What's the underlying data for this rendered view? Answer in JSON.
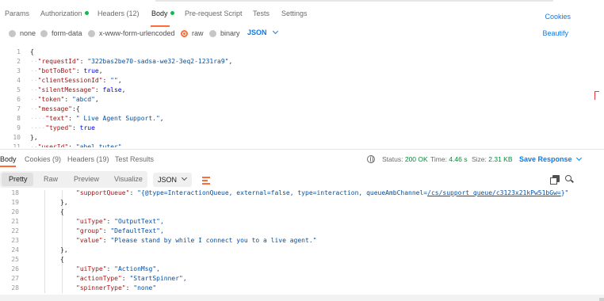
{
  "request_tabs": {
    "params": "Params",
    "authorization": "Authorization",
    "headers": "Headers",
    "headers_count": "(12)",
    "body": "Body",
    "prerequest": "Pre-request Script",
    "tests": "Tests",
    "settings": "Settings",
    "cookies": "Cookies"
  },
  "body_types": {
    "none": "none",
    "form_data": "form-data",
    "urlencoded": "x-www-form-urlencoded",
    "raw": "raw",
    "binary": "binary",
    "format": "JSON",
    "beautify": "Beautify"
  },
  "editor": {
    "lines": [
      {
        "n": "1",
        "text": "{"
      },
      {
        "n": "2",
        "key": "\"requestId\"",
        "val": "\"322bas2be70-sadsa-we32-3eq2-1231ra9\"",
        "vtype": "s"
      },
      {
        "n": "3",
        "key": "\"botToBot\"",
        "val": "true",
        "vtype": "b"
      },
      {
        "n": "4",
        "key": "\"clientSessionId\"",
        "val": "\"\"",
        "vtype": "s"
      },
      {
        "n": "5",
        "key": "\"silentMessage\"",
        "val": "false",
        "vtype": "b"
      },
      {
        "n": "6",
        "key": "\"token\"",
        "val": "\"abcd\"",
        "vtype": "s"
      },
      {
        "n": "7",
        "key": "\"message\"",
        "val": "{",
        "vtype": "p"
      },
      {
        "n": "8",
        "key": "\"text\"",
        "val": "\" Live Agent Support.\"",
        "vtype": "s",
        "deep": true
      },
      {
        "n": "9",
        "key": "\"typed\"",
        "val": "true",
        "vtype": "b",
        "deep": true
      },
      {
        "n": "10",
        "text": "},"
      },
      {
        "n": "11",
        "key": "\"userId\"",
        "val": "\"abel tuter\"",
        "vtype": "s"
      }
    ]
  },
  "response_tabs": {
    "body": "Body",
    "cookies": "Cookies",
    "cookies_count": "(9)",
    "headers": "Headers",
    "headers_count": "(19)",
    "test_results": "Test Results"
  },
  "response_status": {
    "status_label": "Status:",
    "status_value": "200 OK",
    "time_label": "Time:",
    "time_value": "4.46 s",
    "size_label": "Size:",
    "size_value": "2.31 KB",
    "save_response": "Save Response"
  },
  "response_toolbar": {
    "pretty": "Pretty",
    "raw": "Raw",
    "preview": "Preview",
    "visualize": "Visualize",
    "format": "JSON"
  },
  "response_body": {
    "lines": [
      {
        "n": "18",
        "indent": 3,
        "key": "\"supportQueue\"",
        "pre": "\"{@type=InteractionQueue, external=false, type=interaction, queueAmbChannel=",
        "link": "/cs/support_queue/c3123x21kPw51bGw=",
        "post": "}\""
      },
      {
        "n": "19",
        "indent": 2,
        "text": "},"
      },
      {
        "n": "20",
        "indent": 2,
        "text": "{"
      },
      {
        "n": "21",
        "indent": 3,
        "key": "\"uiType\"",
        "val": "\"OutputText\","
      },
      {
        "n": "22",
        "indent": 3,
        "key": "\"group\"",
        "val": "\"DefaultText\","
      },
      {
        "n": "23",
        "indent": 3,
        "key": "\"value\"",
        "val": "\"Please stand by while I connect you to a live agent.\""
      },
      {
        "n": "24",
        "indent": 2,
        "text": "},"
      },
      {
        "n": "25",
        "indent": 2,
        "text": "{"
      },
      {
        "n": "26",
        "indent": 3,
        "key": "\"uiType\"",
        "val": "\"ActionMsg\","
      },
      {
        "n": "27",
        "indent": 3,
        "key": "\"actionType\"",
        "val": "\"StartSpinner\","
      },
      {
        "n": "28",
        "indent": 3,
        "key": "\"spinnerType\"",
        "val": "\"none\""
      }
    ]
  }
}
